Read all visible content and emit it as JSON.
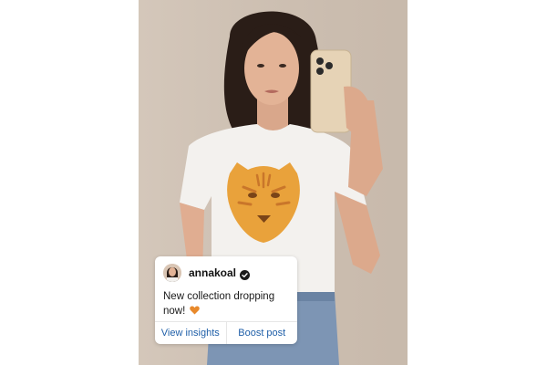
{
  "post": {
    "username": "annakoal",
    "verified": true,
    "caption": "New collection dropping now!",
    "caption_emoji": "orange-heart-icon"
  },
  "actions": {
    "insights_label": "View insights",
    "boost_label": "Boost post"
  },
  "colors": {
    "accent": "#1f5fa8",
    "background": "#cfc1b3",
    "tiger": "#e9a23b"
  }
}
